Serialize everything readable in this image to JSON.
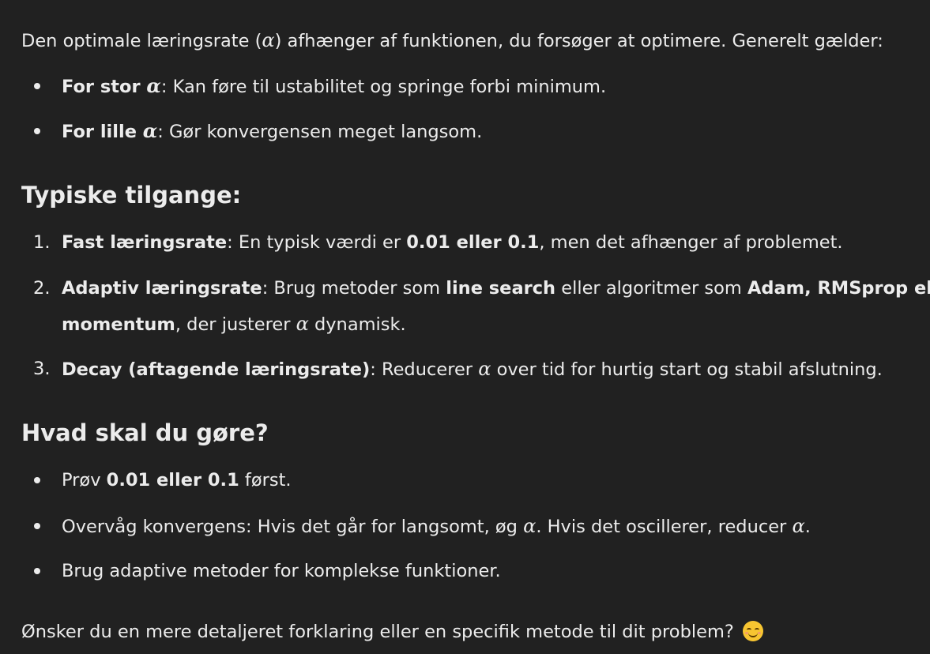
{
  "intro": {
    "prefix": "Den optimale læringsrate (",
    "alpha": "α",
    "suffix": ") afhænger af funktionen, du forsøger at optimere. Generelt gælder:"
  },
  "bullets_top": [
    {
      "bold": "For stor ",
      "alpha": "α",
      "rest": ": Kan føre til ustabilitet og springe forbi minimum."
    },
    {
      "bold": "For lille ",
      "alpha": "α",
      "rest": ": Gør konvergensen meget langsom."
    }
  ],
  "heading1": "Typiske tilgange:",
  "numbered": [
    {
      "num": "1.",
      "bold": "Fast læringsrate",
      "t1": ": En typisk værdi er ",
      "bold2": "0.01 eller 0.1",
      "t2": ", men det afhænger af problemet."
    },
    {
      "num": "2.",
      "bold": "Adaptiv læringsrate",
      "t1": ": Brug metoder som ",
      "bold2": "line search",
      "t2": " eller algoritmer som ",
      "bold3": "Adam, RMSprop eller",
      "bold4": "momentum",
      "t3": ", der justerer ",
      "alpha": "α",
      "t4": " dynamisk."
    },
    {
      "num": "3.",
      "bold": "Decay (aftagende læringsrate)",
      "t1": ": Reducerer ",
      "alpha": "α",
      "t2": " over tid for hurtig start og stabil afslutning."
    }
  ],
  "heading2": "Hvad skal du gøre?",
  "bullets_bottom": [
    {
      "t1": "Prøv ",
      "bold": "0.01 eller 0.1",
      "t2": " først."
    },
    {
      "t1": "Overvåg konvergens: Hvis det går for langsomt, øg ",
      "alpha": "α",
      "t2": ". Hvis det oscillerer, reducer ",
      "alpha2": "α",
      "t3": "."
    },
    {
      "t1": "Brug adaptive metoder for komplekse funktioner."
    }
  ],
  "closing": "Ønsker du en mere detaljeret forklaring eller en specifik metode til dit problem? ",
  "emoji_icon": "smiling-face-icon"
}
